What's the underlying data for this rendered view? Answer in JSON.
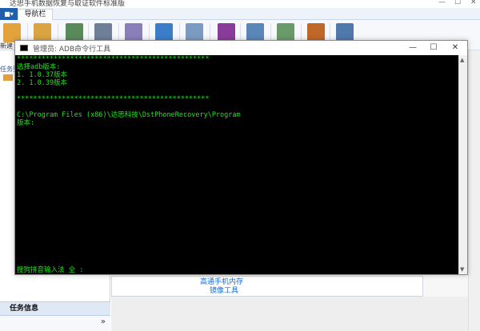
{
  "app": {
    "title": "达思手机数据恢复与取证软件标准版",
    "nav_tab": "导航栏",
    "menu_btn": "■▾",
    "new_label": "新建",
    "left_label": "任务列",
    "task_info": "任务信息",
    "chevron": "»",
    "inner_text_1": "高通手机内存",
    "inner_text_2": "镜像工具"
  },
  "console": {
    "title": "管理员:  ADB命令行工具",
    "min": "—",
    "max": "☐",
    "close": "✕",
    "lines": [
      "***********************************************",
      "选择adb版本:",
      "1. 1.0.37版本",
      "2. 1.0.39版本",
      "",
      "***********************************************",
      "",
      "C:\\Program Files (x86)\\达思科技\\DstPhoneRecovery\\Program",
      "版本:"
    ],
    "ime_line": "搜狗拼音输入法 全 :"
  },
  "colors": {
    "console_text": "#1ee61e",
    "console_bg": "#000000",
    "accent": "#1f5fae",
    "link": "#1a6bd4"
  }
}
